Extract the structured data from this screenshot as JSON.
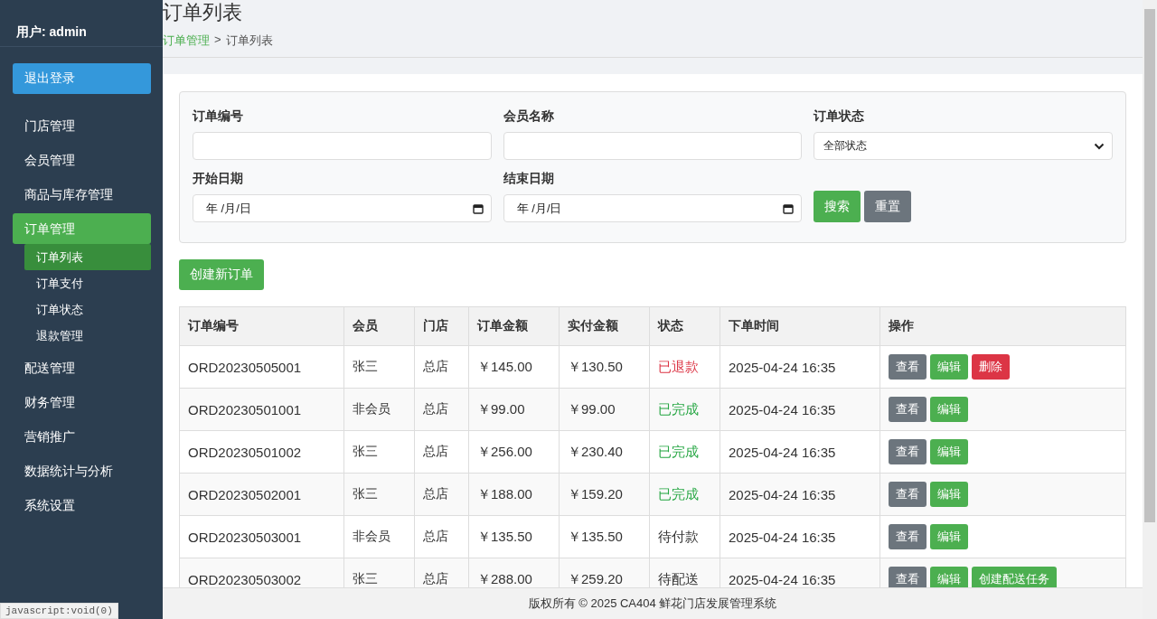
{
  "sidebar": {
    "user": "用户: admin",
    "logout": "退出登录",
    "items": [
      {
        "label": "门店管理",
        "selected": false
      },
      {
        "label": "会员管理",
        "selected": false
      },
      {
        "label": "商品与库存管理",
        "selected": false
      },
      {
        "label": "订单管理",
        "selected": true,
        "children": [
          {
            "label": "订单列表",
            "selected": true
          },
          {
            "label": "订单支付",
            "selected": false
          },
          {
            "label": "订单状态",
            "selected": false
          },
          {
            "label": "退款管理",
            "selected": false
          }
        ]
      },
      {
        "label": "配送管理",
        "selected": false
      },
      {
        "label": "财务管理",
        "selected": false
      },
      {
        "label": "营销推广",
        "selected": false
      },
      {
        "label": "数据统计与分析",
        "selected": false
      },
      {
        "label": "系统设置",
        "selected": false
      }
    ]
  },
  "page": {
    "title": "订单列表",
    "breadcrumb": [
      {
        "label": "订单管理",
        "kind": "link"
      },
      {
        "label": ">",
        "kind": "separator"
      },
      {
        "label": "订单列表",
        "kind": "current"
      }
    ]
  },
  "filters": {
    "fields": [
      {
        "label": "订单编号",
        "kind": "text"
      },
      {
        "label": "会员名称",
        "kind": "text"
      },
      {
        "label": "订单状态",
        "kind": "select",
        "value": "全部状态"
      },
      {
        "label": "开始日期",
        "kind": "date",
        "placeholder": "年 /月/日"
      },
      {
        "label": "结束日期",
        "kind": "date",
        "placeholder": "年 /月/日"
      }
    ],
    "buttons": [
      {
        "label": "搜索",
        "kind": "primary"
      },
      {
        "label": "重置",
        "kind": "secondary"
      }
    ]
  },
  "create_button": "创建新订单",
  "table": {
    "columns": [
      "订单编号",
      "会员",
      "门店",
      "订单金额",
      "实付金额",
      "状态",
      "下单时间",
      "操作"
    ],
    "rows": [
      {
        "id": "ORD20230505001",
        "member": "张三",
        "store": "总店",
        "amount": "￥145.00",
        "paid": "￥130.50",
        "status": "已退款",
        "color": "#dc3545",
        "time": "2025-04-24 16:35",
        "actions": [
          {
            "label": "查看",
            "kind": "view"
          },
          {
            "label": "编辑",
            "kind": "edit"
          },
          {
            "label": "删除",
            "kind": "delete"
          }
        ]
      },
      {
        "id": "ORD20230501001",
        "member": "非会员",
        "store": "总店",
        "amount": "￥99.00",
        "paid": "￥99.00",
        "status": "已完成",
        "color": "#28a745",
        "time": "2025-04-24 16:35",
        "actions": [
          {
            "label": "查看",
            "kind": "view"
          },
          {
            "label": "编辑",
            "kind": "edit"
          }
        ]
      },
      {
        "id": "ORD20230501002",
        "member": "张三",
        "store": "总店",
        "amount": "￥256.00",
        "paid": "￥230.40",
        "status": "已完成",
        "color": "#28a745",
        "time": "2025-04-24 16:35",
        "actions": [
          {
            "label": "查看",
            "kind": "view"
          },
          {
            "label": "编辑",
            "kind": "edit"
          }
        ]
      },
      {
        "id": "ORD20230502001",
        "member": "张三",
        "store": "总店",
        "amount": "￥188.00",
        "paid": "￥159.20",
        "status": "已完成",
        "color": "#28a745",
        "time": "2025-04-24 16:35",
        "actions": [
          {
            "label": "查看",
            "kind": "view"
          },
          {
            "label": "编辑",
            "kind": "edit"
          }
        ]
      },
      {
        "id": "ORD20230503001",
        "member": "非会员",
        "store": "总店",
        "amount": "￥135.50",
        "paid": "￥135.50",
        "status": "待付款",
        "color": "#333333",
        "time": "2025-04-24 16:35",
        "actions": [
          {
            "label": "查看",
            "kind": "view"
          },
          {
            "label": "编辑",
            "kind": "edit"
          }
        ]
      },
      {
        "id": "ORD20230503002",
        "member": "张三",
        "store": "总店",
        "amount": "￥288.00",
        "paid": "￥259.20",
        "status": "待配送",
        "color": "#333333",
        "time": "2025-04-24 16:35",
        "actions": [
          {
            "label": "查看",
            "kind": "view"
          },
          {
            "label": "编辑",
            "kind": "edit"
          },
          {
            "label": "创建配送任务",
            "kind": "dispatch"
          }
        ]
      }
    ]
  },
  "footer": "版权所有 © 2025 CA404 鲜花门店发展管理系统",
  "status_url": "javascript:void(0)"
}
